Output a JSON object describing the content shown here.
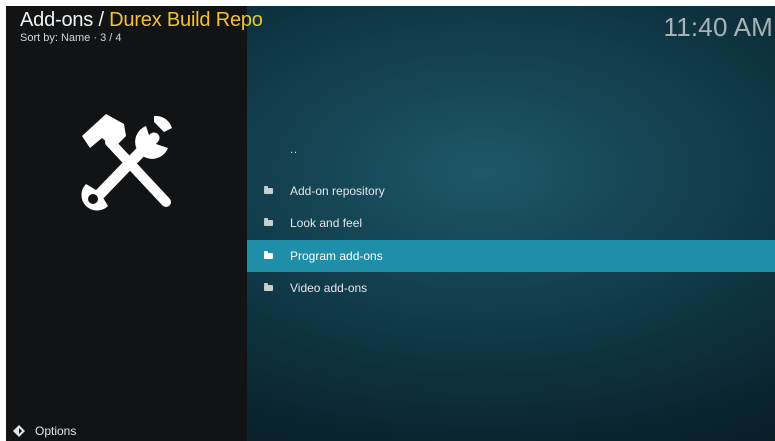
{
  "header": {
    "section": "Add-ons",
    "separator": " / ",
    "current": "Durex Build Repo",
    "sort_info": "Sort by: Name  ·  3 / 4",
    "clock": "11:40 AM"
  },
  "left_panel": {
    "icon": "hammer-wrench-icon"
  },
  "list": {
    "parent_label": "..",
    "items": [
      {
        "label": "Add-on repository",
        "icon": "folder-icon"
      },
      {
        "label": "Look and feel",
        "icon": "folder-icon"
      },
      {
        "label": "Program add-ons",
        "icon": "folder-icon",
        "selected": true
      },
      {
        "label": "Video add-ons",
        "icon": "folder-icon"
      }
    ]
  },
  "footer": {
    "options_label": "Options",
    "icon": "options-icon"
  },
  "colors": {
    "accent": "#f2c230",
    "selection": "#1f8ea8",
    "panel": "#121314"
  }
}
